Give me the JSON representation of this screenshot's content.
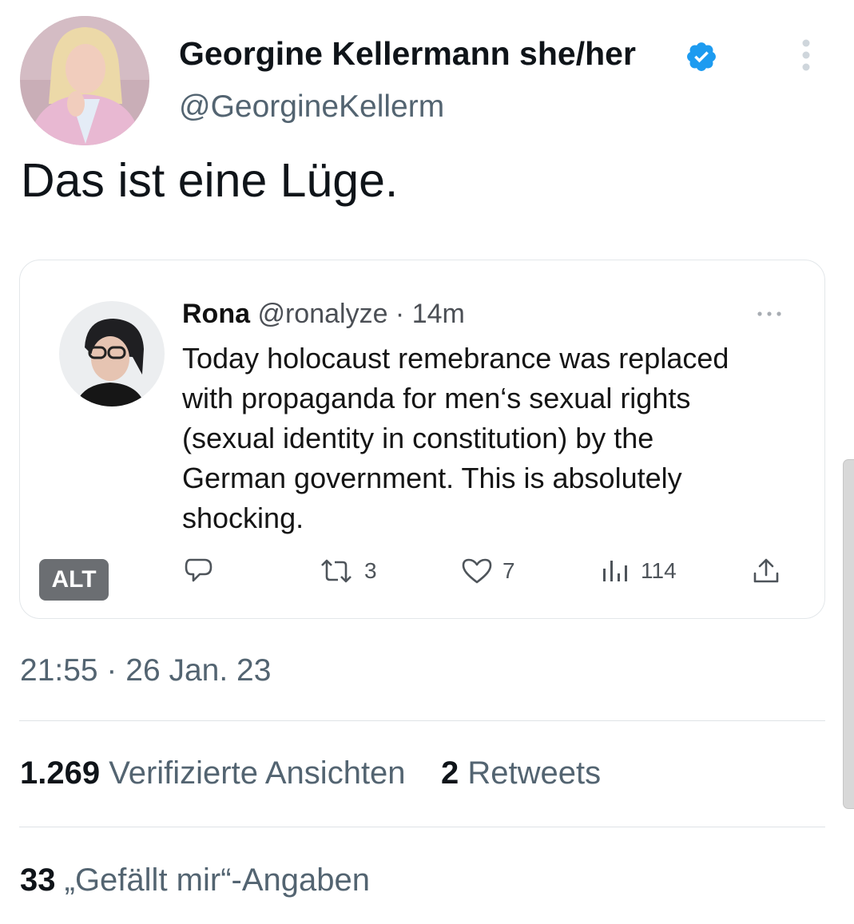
{
  "author": {
    "name": "Georgine Kellermann she/her",
    "handle": "@GeorgineKellerm"
  },
  "tweet": {
    "text": "Das ist eine Lüge.",
    "timestamp": "21:55 · 26 Jan. 23"
  },
  "quoted": {
    "name": "Rona",
    "handle": "@ronalyze",
    "time": " · 14m",
    "lines": [
      "Today holocaust remebrance was replaced",
      "with propaganda for men‘s sexual rights",
      "(sexual identity in constitution) by the",
      "German government. This is absolutely",
      "shocking."
    ],
    "actions": {
      "retweets": "3",
      "likes": "7",
      "views": "114"
    },
    "alt_label": "ALT"
  },
  "stats": {
    "views_count": "1.269",
    "views_label": "Verifizierte Ansichten",
    "retweets_count": "2",
    "retweets_label": "Retweets",
    "likes_count": "33",
    "likes_label": "„Gefällt mir“-Angaben"
  },
  "colors": {
    "verified": "#1d9bf0",
    "muted_text": "#536471",
    "divider": "#dfe3e6"
  }
}
